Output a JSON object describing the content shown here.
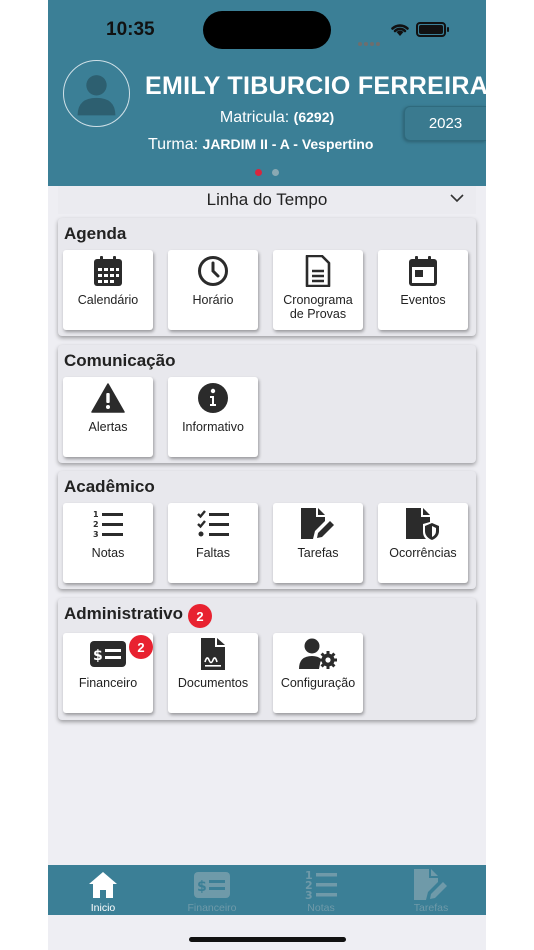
{
  "status_bar": {
    "time": "10:35"
  },
  "profile": {
    "name": "EMILY TIBURCIO FERREIRA",
    "matricula_label": "Matricula:",
    "matricula_value": "(6292)",
    "turma_label": "Turma:",
    "turma_value": "JARDIM II - A - Vespertino",
    "year": "2023"
  },
  "timeline": {
    "label": "Linha do Tempo"
  },
  "sections": [
    {
      "title": "Agenda",
      "items": [
        {
          "label_lines": [
            "Calendário"
          ],
          "icon": "calendar-icon"
        },
        {
          "label_lines": [
            "Horário"
          ],
          "icon": "clock-icon"
        },
        {
          "label_lines": [
            "Cronograma",
            "de Provas"
          ],
          "icon": "document-icon"
        },
        {
          "label_lines": [
            "Eventos"
          ],
          "icon": "calendar-event-icon"
        }
      ]
    },
    {
      "title": "Comunicação",
      "items": [
        {
          "label_lines": [
            "Alertas"
          ],
          "icon": "warning-icon"
        },
        {
          "label_lines": [
            "Informativo"
          ],
          "icon": "info-icon"
        }
      ]
    },
    {
      "title": "Acadêmico",
      "items": [
        {
          "label_lines": [
            "Notas"
          ],
          "icon": "numbered-list-icon"
        },
        {
          "label_lines": [
            "Faltas"
          ],
          "icon": "checklist-icon"
        },
        {
          "label_lines": [
            "Tarefas"
          ],
          "icon": "file-edit-icon"
        },
        {
          "label_lines": [
            "Ocorrências"
          ],
          "icon": "file-shield-icon"
        }
      ]
    },
    {
      "title": "Administrativo",
      "badge": "2",
      "items": [
        {
          "label_lines": [
            "Financeiro"
          ],
          "icon": "money-card-icon",
          "badge": "2"
        },
        {
          "label_lines": [
            "Documentos"
          ],
          "icon": "signed-document-icon"
        },
        {
          "label_lines": [
            "Configuração"
          ],
          "icon": "user-gear-icon"
        }
      ]
    }
  ],
  "tabbar": [
    {
      "label": "Inicio",
      "icon": "home-icon",
      "active": true
    },
    {
      "label": "Financeiro",
      "icon": "money-card-icon",
      "active": false
    },
    {
      "label": "Notas",
      "icon": "numbered-list-icon",
      "active": false
    },
    {
      "label": "Tarefas",
      "icon": "file-edit-icon",
      "active": false
    }
  ],
  "colors": {
    "header": "#3b7f96",
    "badge": "#e82230",
    "background": "#eeeef3"
  }
}
